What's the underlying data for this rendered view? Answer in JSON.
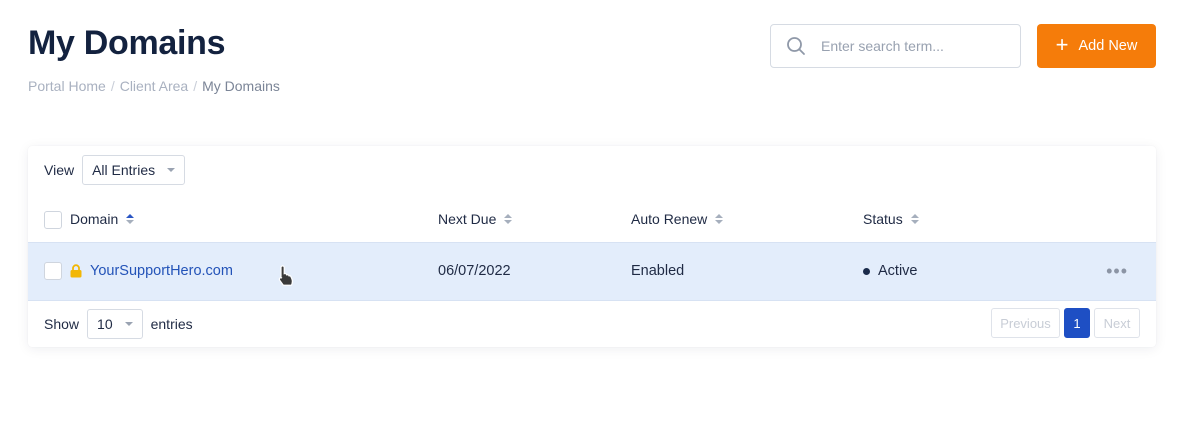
{
  "header": {
    "title": "My Domains",
    "breadcrumb": [
      "Portal Home",
      "Client Area",
      "My Domains"
    ],
    "search_placeholder": "Enter search term...",
    "add_button_label": "Add New"
  },
  "table": {
    "view_label": "View",
    "view_selected": "All Entries",
    "columns": [
      "Domain",
      "Next Due",
      "Auto Renew",
      "Status"
    ],
    "rows": [
      {
        "domain": "YourSupportHero.com",
        "next_due": "06/07/2022",
        "auto_renew": "Enabled",
        "status": "Active"
      }
    ],
    "footer": {
      "show_label": "Show",
      "page_size": "10",
      "entries_label": "entries"
    },
    "pagination": {
      "previous": "Previous",
      "current": "1",
      "next": "Next"
    }
  },
  "colors": {
    "accent": "#f57c0a",
    "link": "#2353b8",
    "row_highlight": "#e3edfb",
    "pagination_active": "#1e4fc4"
  },
  "icons": [
    "search-icon",
    "plus-icon",
    "lock-icon",
    "more-icon",
    "pointer-cursor-icon"
  ]
}
